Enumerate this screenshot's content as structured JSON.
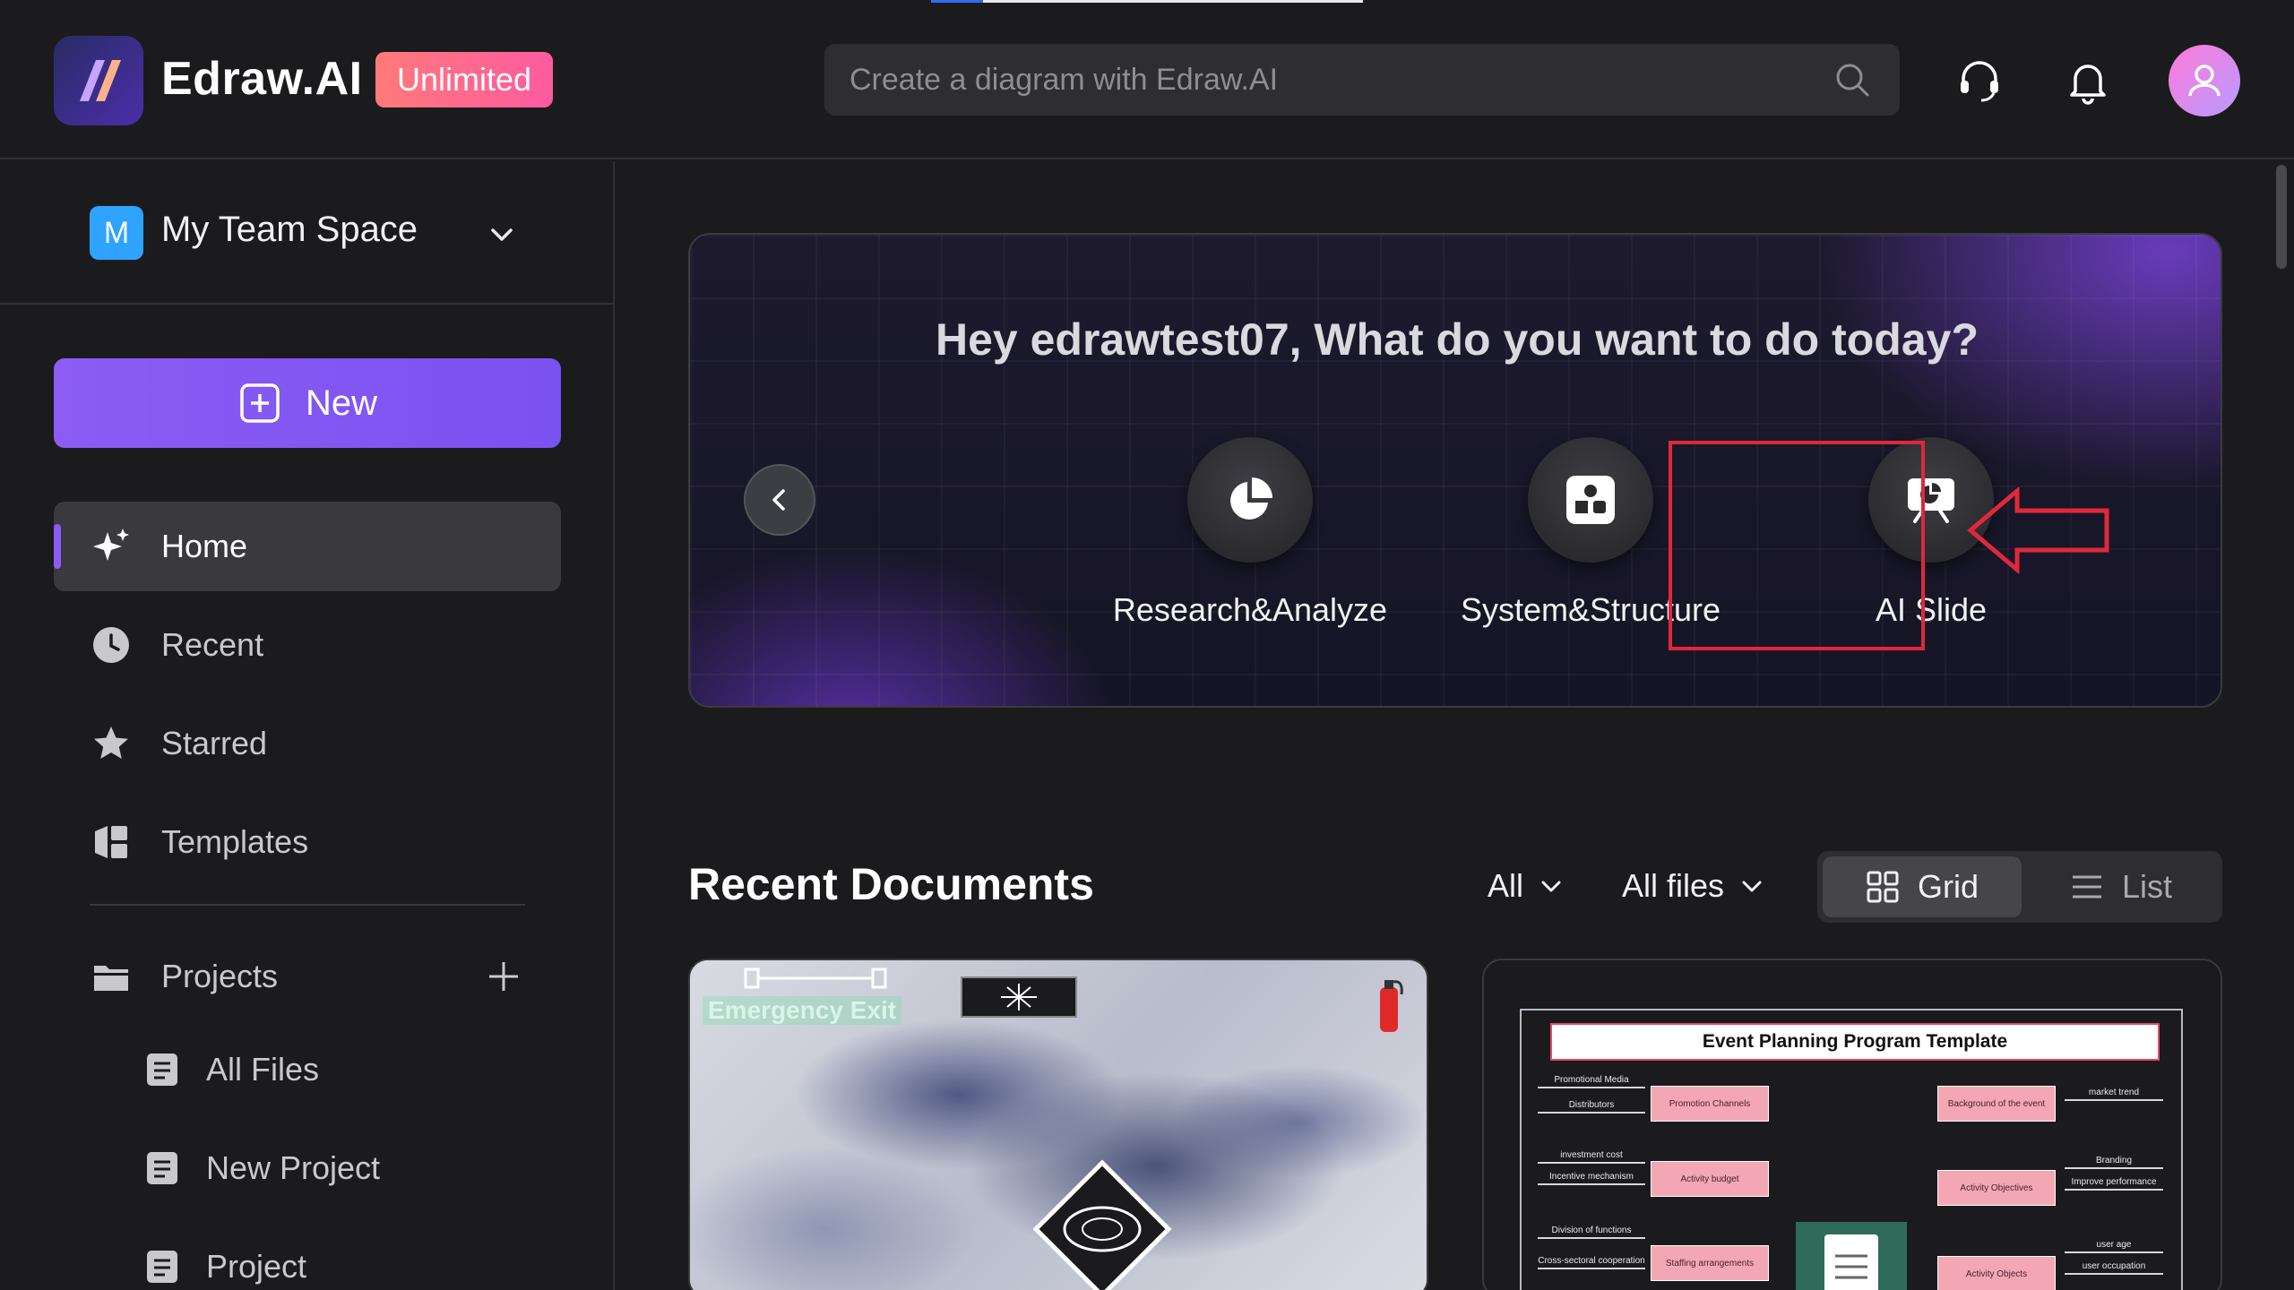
{
  "app": {
    "brand": "Edraw.AI",
    "plan_badge": "Unlimited",
    "top_progress": 0.12,
    "search": {
      "placeholder": "Create a diagram with Edraw.AI"
    },
    "icons": {
      "support": "headset-icon",
      "notifications": "bell-icon",
      "avatar": "user-avatar",
      "search": "search-icon"
    }
  },
  "sidebar": {
    "team": {
      "badge": "M",
      "name": "My Team Space"
    },
    "new_label": "New",
    "nav": [
      {
        "label": "Home",
        "icon": "sparkle-icon",
        "active": true
      },
      {
        "label": "Recent",
        "icon": "clock-icon"
      },
      {
        "label": "Starred",
        "icon": "star-icon"
      },
      {
        "label": "Templates",
        "icon": "templates-icon"
      }
    ],
    "projects_label": "Projects",
    "project_items": [
      {
        "label": "All Files",
        "icon": "file-stack-icon"
      },
      {
        "label": "New Project",
        "icon": "file-stack-icon"
      },
      {
        "label": "Project",
        "icon": "file-stack-icon"
      }
    ]
  },
  "hero": {
    "greeting": "Hey edrawtest07, What do you want to do today?",
    "actions": [
      {
        "label": "Research&Analyze",
        "icon": "pie-chart-icon"
      },
      {
        "label": "System&Structure",
        "icon": "shapes-icon"
      },
      {
        "label": "AI Slide",
        "icon": "presentation-icon",
        "highlighted": true
      }
    ],
    "highlight_color": "#e0283a"
  },
  "recent": {
    "title": "Recent Documents",
    "filter_owner": "All",
    "filter_type": "All files",
    "view_grid": "Grid",
    "view_list": "List",
    "cards": [
      {
        "preview": "floor-plan-map",
        "label_visible": "Emergency Exit"
      },
      {
        "preview_title": "Event Planning Program Template",
        "left_items": [
          "Promotional Media",
          "Distributors",
          "investment cost",
          "Incentive mechanism",
          "Division of functions",
          "Cross-sectoral cooperation"
        ],
        "mid_left": [
          "Promotion Channels",
          "Activity budget",
          "Staffing arrangements"
        ],
        "mid_right": [
          "Background of the event",
          "Activity Objectives",
          "Activity Objects"
        ],
        "right_items": [
          "market trend",
          "Branding",
          "Improve performance",
          "user age",
          "user occupation"
        ]
      }
    ]
  },
  "colors": {
    "accent": "#8c5cf5",
    "badge_gradient_start": "#ff7a7a",
    "badge_gradient_end": "#ff5aa0",
    "team_badge": "#2ea3ff"
  }
}
